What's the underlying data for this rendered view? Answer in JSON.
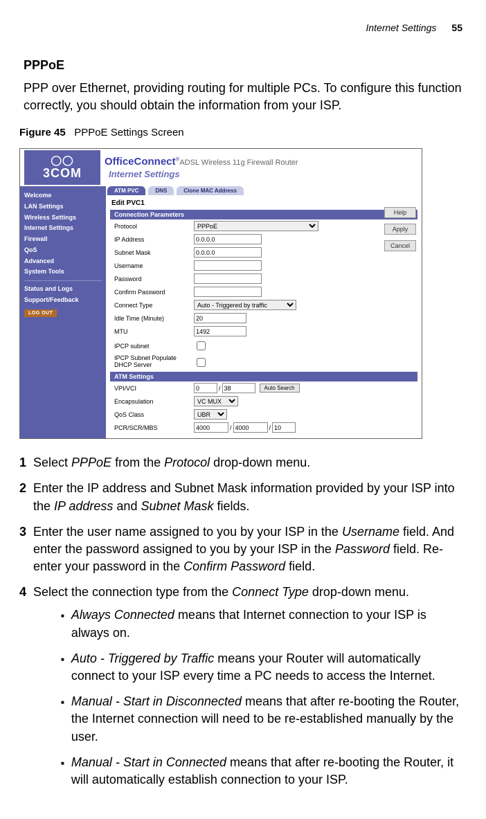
{
  "header": {
    "title": "Internet Settings",
    "page": "55"
  },
  "section": {
    "title": "PPPoE",
    "intro": "PPP over Ethernet, providing routing for multiple PCs. To configure this function correctly, you should obtain the information from your ISP."
  },
  "figure": {
    "label": "Figure 45",
    "caption": "PPPoE Settings Screen"
  },
  "screenshot": {
    "logo_text": "3COM",
    "brand_oc": "OfficeConnect",
    "brand_suffix": "ADSL Wireless 11g Firewall Router",
    "brand_sub": "Internet Settings",
    "tabs": [
      "ATM PVC",
      "DNS",
      "Clone MAC Address"
    ],
    "sidebar": {
      "items": [
        "Welcome",
        "LAN Settings",
        "Wireless Settings",
        "Internet Settings",
        "Firewall",
        "QoS",
        "Advanced",
        "System Tools"
      ],
      "lower": [
        "Status and Logs",
        "Support/Feedback"
      ],
      "logout": "LOG OUT"
    },
    "edit_title": "Edit PVC1",
    "panel1": "Connection Parameters",
    "rows": {
      "protocol": {
        "label": "Protocol",
        "value": "PPPoE"
      },
      "ip": {
        "label": "IP Address",
        "value": "0.0.0.0"
      },
      "subnet": {
        "label": "Subnet Mask",
        "value": "0.0.0.0"
      },
      "username": {
        "label": "Username",
        "value": ""
      },
      "password": {
        "label": "Password",
        "value": ""
      },
      "confirm": {
        "label": "Confirm Password",
        "value": ""
      },
      "connect": {
        "label": "Connect Type",
        "value": "Auto - Triggered by traffic"
      },
      "idle": {
        "label": "Idle Time (Minute)",
        "value": "20"
      },
      "mtu": {
        "label": "MTU",
        "value": "1492"
      },
      "ipcp1": {
        "label": "IPCP subnet"
      },
      "ipcp2": {
        "label": "IPCP Subnet Populate DHCP Server"
      }
    },
    "panel2": "ATM Settings",
    "atm": {
      "vpi": {
        "label": "VPI/VCI",
        "v1": "0",
        "v2": "38",
        "btn": "Auto Search"
      },
      "encap": {
        "label": "Encapsulation",
        "value": "VC MUX"
      },
      "qos": {
        "label": "QoS Class",
        "value": "UBR"
      },
      "pcr": {
        "label": "PCR/SCR/MBS",
        "v1": "4000",
        "v2": "4000",
        "v3": "10"
      }
    },
    "buttons": {
      "help": "Help",
      "apply": "Apply",
      "cancel": "Cancel"
    }
  },
  "steps": {
    "s1_a": "Select ",
    "s1_i1": "PPPoE",
    "s1_b": " from the ",
    "s1_i2": "Protocol",
    "s1_c": " drop-down menu.",
    "s2_a": "Enter the IP address and Subnet Mask information provided by your ISP into the ",
    "s2_i1": "IP address",
    "s2_b": " and ",
    "s2_i2": "Subnet Mask",
    "s2_c": " fields.",
    "s3_a": "Enter the user name assigned to you by your ISP in the ",
    "s3_i1": "Username",
    "s3_b": " field. And enter the password assigned to you by your ISP in the ",
    "s3_i2": "Password",
    "s3_c": " field. Re-enter your password in the ",
    "s3_i3": "Confirm Password",
    "s3_d": " field.",
    "s4_a": "Select the connection type from the ",
    "s4_i1": "Connect Type",
    "s4_b": " drop-down menu."
  },
  "bullets": {
    "b1_i": "Always Connected",
    "b1_t": " means that Internet connection to your ISP is always on.",
    "b2_i": "Auto - Triggered by Traffic",
    "b2_t": " means your Router will automatically connect to your ISP every time a PC needs to access the Internet.",
    "b3_i": "Manual - Start in Disconnected",
    "b3_t": " means that after re-booting the Router, the Internet connection will need to be re-established manually by the user.",
    "b4_i": "Manual - Start in Connected",
    "b4_t": " means that after re-booting the Router, it will automatically establish connection to your ISP."
  }
}
